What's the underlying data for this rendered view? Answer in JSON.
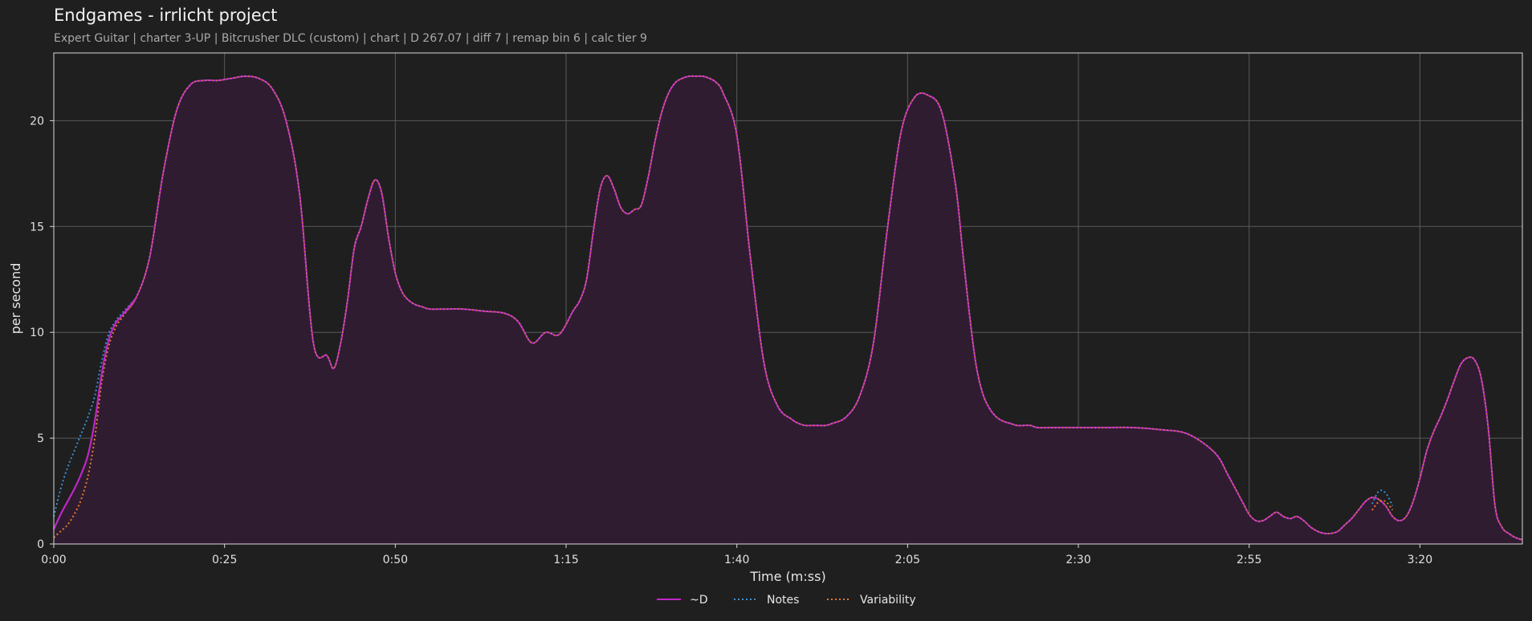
{
  "header": {
    "title": "Endgames - irrlicht project",
    "subtitle": "Expert Guitar  |  charter 3-UP  |  Bitcrusher DLC (custom)  |  chart  |  D 267.07  |  diff 7  |  remap bin 6  |  calc tier 9"
  },
  "chart_data": {
    "type": "line",
    "title": "Endgames - irrlicht project",
    "xlabel": "Time (m:ss)",
    "ylabel": "per second",
    "xlim": [
      0,
      215
    ],
    "ylim": [
      0,
      23.2
    ],
    "grid": true,
    "legend_position": "bottom-center",
    "x_ticks": [
      0,
      25,
      50,
      75,
      100,
      125,
      150,
      175,
      200
    ],
    "x_tick_labels": [
      "0:00",
      "0:25",
      "0:50",
      "1:15",
      "1:40",
      "2:05",
      "2:30",
      "2:55",
      "3:20"
    ],
    "y_ticks": [
      0,
      5,
      10,
      15,
      20
    ],
    "y_tick_labels": [
      "0",
      "5",
      "10",
      "15",
      "20"
    ],
    "series": [
      {
        "name": "~D",
        "color": "#c026c8",
        "style": "solid",
        "filled": true,
        "x": [
          0,
          1,
          2,
          3,
          4,
          5,
          6,
          7,
          8,
          9,
          10,
          12,
          14,
          16,
          18,
          20,
          22,
          24,
          26,
          28,
          30,
          32,
          34,
          36,
          38,
          40,
          41,
          42,
          43,
          44,
          45,
          46,
          47,
          48,
          49,
          50,
          51,
          52,
          53,
          54,
          55,
          57,
          60,
          63,
          66,
          68,
          70,
          72,
          74,
          76,
          77,
          78,
          79,
          80,
          81,
          82,
          83,
          84,
          85,
          86,
          87,
          88,
          89,
          90,
          91,
          92,
          93,
          94,
          95,
          96,
          97,
          98,
          100,
          102,
          104,
          106,
          108,
          109,
          110,
          111,
          112,
          113,
          114,
          116,
          118,
          120,
          122,
          124,
          126,
          128,
          130,
          132,
          133,
          134,
          135,
          136,
          137,
          138,
          139,
          140,
          141,
          142,
          143,
          144,
          146,
          148,
          150,
          154,
          158,
          162,
          166,
          170,
          172,
          174,
          175,
          176,
          177,
          178,
          179,
          180,
          181,
          182,
          183,
          184,
          185,
          186,
          187,
          188,
          189,
          190,
          191,
          192,
          193,
          194,
          195,
          196,
          197,
          198,
          199,
          200,
          201,
          202,
          203,
          204,
          205,
          206,
          207,
          208,
          209,
          210,
          211,
          212,
          213,
          214,
          215
        ],
        "values": [
          0.7,
          1.4,
          2.0,
          2.6,
          3.3,
          4.2,
          5.8,
          8.0,
          9.6,
          10.4,
          10.8,
          11.6,
          13.5,
          17.5,
          20.5,
          21.7,
          21.9,
          21.9,
          22.0,
          22.1,
          22.0,
          21.5,
          20.0,
          16.5,
          9.5,
          8.9,
          8.3,
          9.5,
          11.5,
          14.0,
          15.0,
          16.3,
          17.2,
          16.6,
          14.5,
          12.8,
          11.9,
          11.5,
          11.3,
          11.2,
          11.1,
          11.1,
          11.1,
          11.0,
          10.9,
          10.5,
          9.5,
          10.0,
          9.9,
          11.0,
          11.5,
          12.5,
          14.8,
          16.8,
          17.4,
          16.8,
          15.9,
          15.6,
          15.8,
          16.0,
          17.3,
          19.0,
          20.4,
          21.3,
          21.8,
          22.0,
          22.1,
          22.1,
          22.1,
          22.0,
          21.8,
          21.3,
          19.3,
          13.5,
          8.5,
          6.5,
          5.9,
          5.7,
          5.6,
          5.6,
          5.6,
          5.6,
          5.7,
          6.0,
          7.0,
          9.5,
          14.8,
          19.4,
          21.1,
          21.2,
          20.4,
          17.0,
          14.0,
          11.0,
          8.5,
          7.1,
          6.4,
          6.0,
          5.8,
          5.7,
          5.6,
          5.6,
          5.6,
          5.5,
          5.5,
          5.5,
          5.5,
          5.5,
          5.5,
          5.4,
          5.2,
          4.3,
          3.2,
          2.0,
          1.4,
          1.1,
          1.1,
          1.3,
          1.5,
          1.3,
          1.2,
          1.3,
          1.1,
          0.8,
          0.6,
          0.5,
          0.5,
          0.6,
          0.9,
          1.2,
          1.6,
          2.0,
          2.2,
          2.1,
          1.8,
          1.3,
          1.1,
          1.3,
          2.0,
          3.1,
          4.4,
          5.3,
          6.0,
          6.8,
          7.7,
          8.5,
          8.8,
          8.7,
          7.8,
          5.5,
          1.8,
          0.8,
          0.5,
          0.3,
          0.2
        ],
        "x_span_note": ""
      },
      {
        "name": "Notes",
        "color": "#3a8fd6",
        "style": "dotted",
        "x": [
          0,
          1,
          2,
          3,
          4,
          5,
          6,
          7,
          8,
          9,
          10,
          12
        ],
        "values": [
          1.3,
          2.6,
          3.6,
          4.4,
          5.2,
          6.0,
          7.0,
          8.6,
          9.9,
          10.5,
          10.9,
          11.6
        ],
        "x_extra": [
          193,
          194,
          195,
          196
        ],
        "values_extra": [
          1.9,
          2.5,
          2.4,
          1.8
        ]
      },
      {
        "name": "Variability",
        "color": "#e87a2a",
        "style": "dotted",
        "x": [
          0,
          1,
          2,
          3,
          4,
          5,
          6,
          7,
          8,
          9,
          10,
          12
        ],
        "values": [
          0.3,
          0.6,
          0.9,
          1.4,
          2.1,
          3.2,
          5.0,
          7.6,
          9.3,
          10.2,
          10.7,
          11.6
        ],
        "x_extra": [
          193,
          194,
          195,
          196
        ],
        "values_extra": [
          1.6,
          2.0,
          2.0,
          1.6
        ]
      }
    ]
  }
}
